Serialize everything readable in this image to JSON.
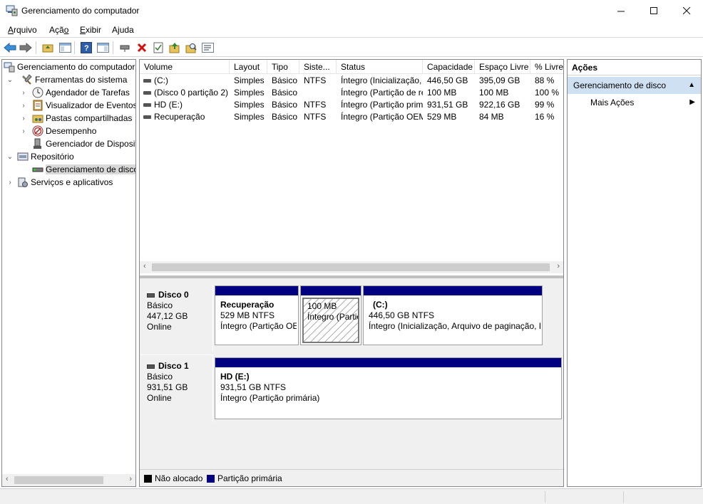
{
  "window": {
    "title": "Gerenciamento do computador",
    "minimize": "—",
    "maximize": "☐",
    "close": "✕"
  },
  "menu": {
    "items": [
      "Arquivo",
      "Ação",
      "Exibir",
      "Ajuda"
    ]
  },
  "tree": {
    "root": "Gerenciamento do computador (Local)",
    "system_tools": "Ferramentas do sistema",
    "task_scheduler": "Agendador de Tarefas",
    "event_viewer": "Visualizador de Eventos",
    "shared_folders": "Pastas compartilhadas",
    "performance": "Desempenho",
    "device_manager": "Gerenciador de Dispositivos",
    "storage": "Repositório",
    "disk_management": "Gerenciamento de disco",
    "services_apps": "Serviços e aplicativos"
  },
  "volumes": {
    "headers": [
      "Volume",
      "Layout",
      "Tipo",
      "Sistema de arquivos",
      "Status",
      "Capacidade",
      "Espaço Livre",
      "% Livre"
    ],
    "header_display": [
      "Volume",
      "Layout",
      "Tipo",
      "Siste...",
      "Status",
      "Capacidade",
      "Espaço Livre",
      "% Livre"
    ],
    "rows": [
      {
        "volume": "(C:)",
        "layout": "Simples",
        "tipo": "Básico",
        "fs": "NTFS",
        "status": "Íntegro (Inicialização, Arquivo de paginação, ...",
        "capacidade": "446,50 GB",
        "livre": "395,09 GB",
        "pct": "88 %"
      },
      {
        "volume": "(Disco 0 partição 2)",
        "layout": "Simples",
        "tipo": "Básico",
        "fs": "",
        "status": "Íntegro (Partição de recuperação)",
        "capacidade": "100 MB",
        "livre": "100 MB",
        "pct": "100 %"
      },
      {
        "volume": "HD (E:)",
        "layout": "Simples",
        "tipo": "Básico",
        "fs": "NTFS",
        "status": "Íntegro (Partição primária)",
        "capacidade": "931,51 GB",
        "livre": "922,16 GB",
        "pct": "99 %"
      },
      {
        "volume": "Recuperação",
        "layout": "Simples",
        "tipo": "Básico",
        "fs": "NTFS",
        "status": "Íntegro (Partição OEM)",
        "capacidade": "529 MB",
        "livre": "84 MB",
        "pct": "16 %"
      }
    ]
  },
  "disks": [
    {
      "name": "Disco 0",
      "type": "Básico",
      "size": "447,12 GB",
      "state": "Online",
      "partitions": [
        {
          "title": "Recuperação",
          "size": "529 MB NTFS",
          "status": "Íntegro (Partição OEM)"
        },
        {
          "title": "",
          "size": "100 MB",
          "status": "Íntegro (Partição de recuperação)"
        },
        {
          "title": "(C:)",
          "size": "446,50 GB NTFS",
          "status": "Íntegro (Inicialização, Arquivo de paginação, Despejo de memória, Partição primária)"
        }
      ]
    },
    {
      "name": "Disco 1",
      "type": "Básico",
      "size": "931,51 GB",
      "state": "Online",
      "partitions": [
        {
          "title": "HD  (E:)",
          "size": "931,51 GB NTFS",
          "status": "Íntegro (Partição primária)"
        }
      ]
    }
  ],
  "legend": {
    "unallocated": "Não alocado",
    "primary": "Partição primária",
    "unallocated_color": "#000000",
    "primary_color": "#000080"
  },
  "actions": {
    "title": "Ações",
    "section": "Gerenciamento de disco",
    "more": "Mais Ações"
  }
}
